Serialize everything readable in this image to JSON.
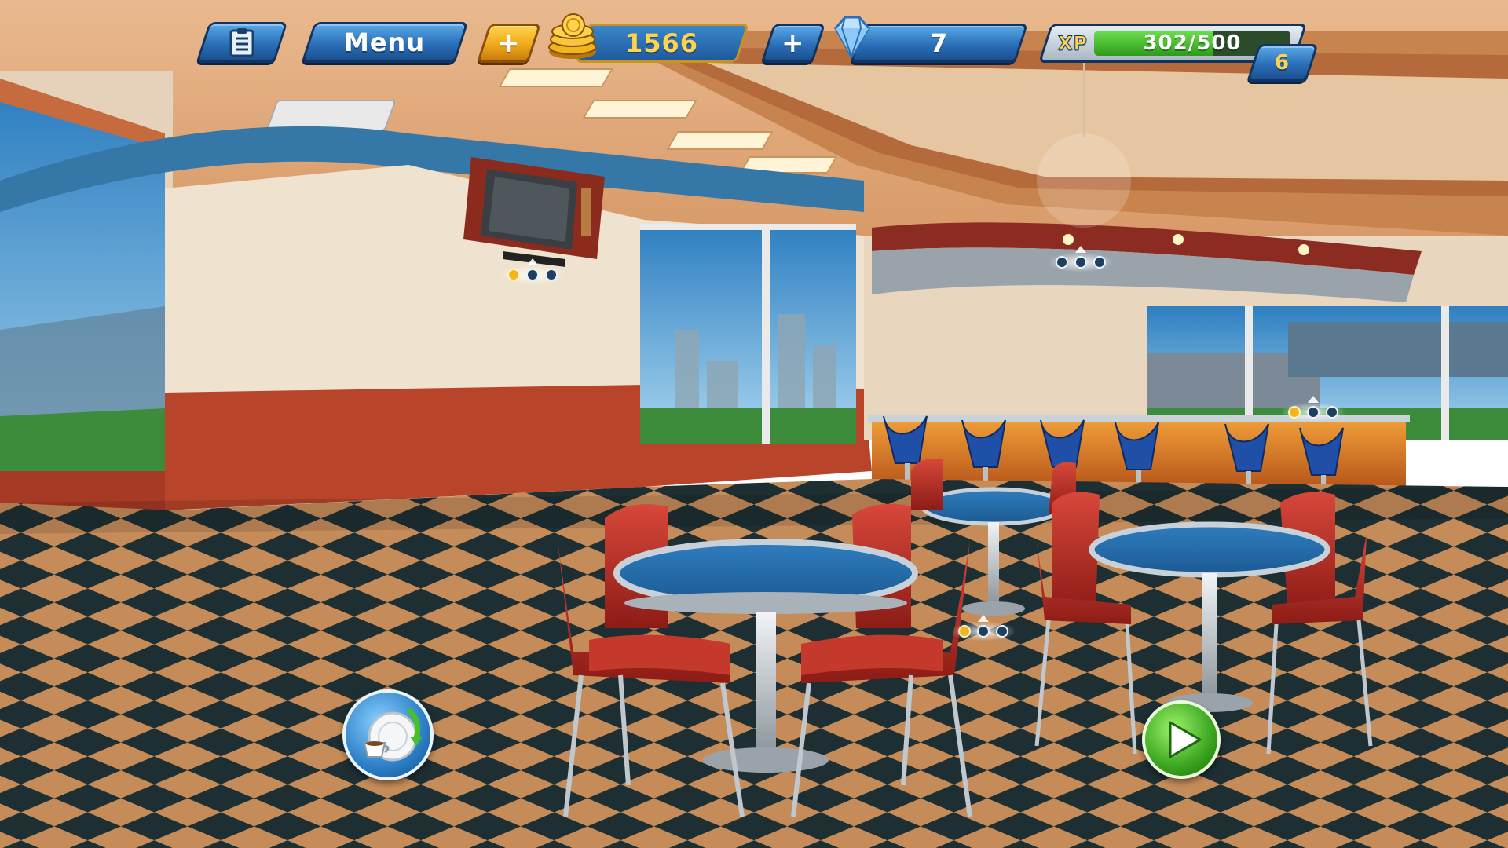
{
  "hud": {
    "menu_label": "Menu",
    "coins": "1566",
    "gems": "7",
    "xp_label": "XP",
    "xp_text": "302/500",
    "xp_progress": 0.604,
    "level": "6",
    "add_symbol": "+"
  },
  "icons": {
    "tasks": "clipboard-icon",
    "coins": "coin-stack-icon",
    "gems": "diamond-icon",
    "dishes": "plate-cup-icon",
    "play": "play-icon"
  },
  "colors": {
    "hud_blue": "#2a6fb8",
    "hud_gold": "#f0a81a",
    "xp_green": "#3fbf2a",
    "coins_text": "#ffd34d"
  }
}
